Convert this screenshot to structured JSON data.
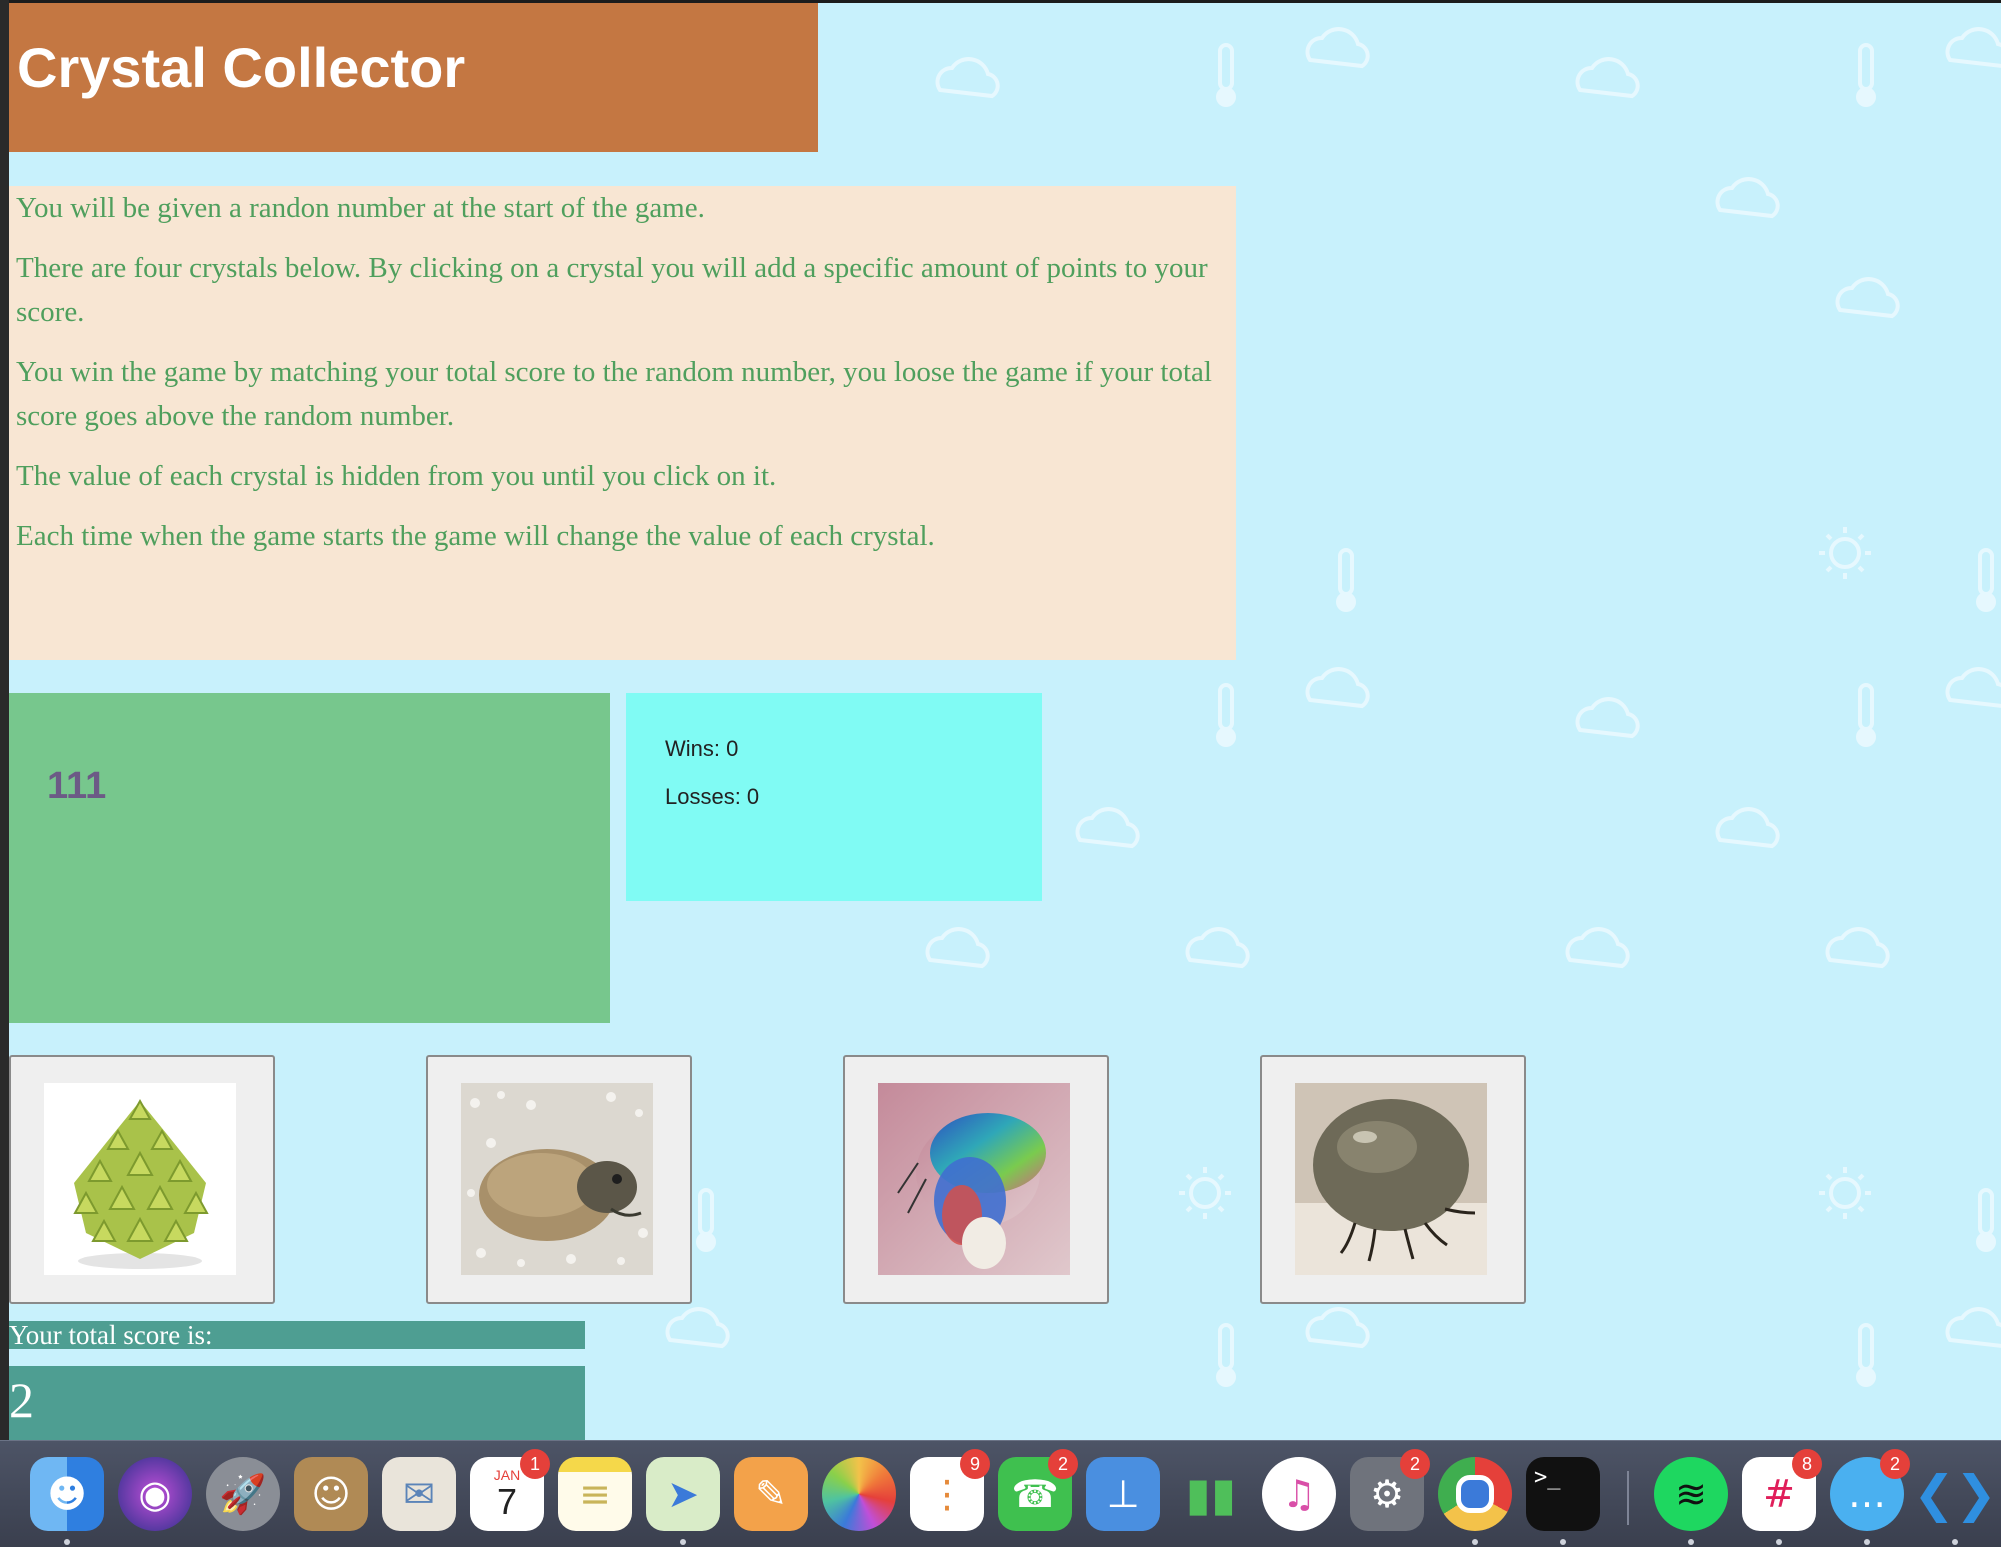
{
  "app": {
    "title": "Crystal Collector"
  },
  "instructions": [
    "You will be given a randon number at the start of the game.",
    "There are four crystals below. By clicking on a crystal you will add a specific amount of points to your score.",
    "You win the game by matching your total score to the random number, you loose the game if your total score goes above the random number.",
    "The value of each crystal is hidden from you until you click on it.",
    "Each time when the game starts the game will change the value of each crystal."
  ],
  "target_number": "111",
  "stats": {
    "wins": "Wins: 0",
    "losses": "Losses: 0"
  },
  "crystals": [
    {
      "image": "romanesco-broccoli"
    },
    {
      "image": "toad-in-sand"
    },
    {
      "image": "iridescent-beetle"
    },
    {
      "image": "engorged-tick"
    }
  ],
  "score": {
    "label": "Your total score is:",
    "value": "2"
  },
  "colors": {
    "page_bg": "#c8f1fc",
    "title_bg": "#c47742",
    "instructions_bg": "#f8e6d3",
    "instructions_text": "#4f9f5d",
    "target_bg": "#77c78d",
    "target_text": "#6c5a86",
    "stats_bg": "#80fbf4",
    "score_bg": "#4e9e92"
  },
  "dock": {
    "apps": [
      {
        "name": "Finder",
        "icon": "finder-icon",
        "running": true
      },
      {
        "name": "Siri",
        "icon": "siri-icon",
        "running": false
      },
      {
        "name": "Launchpad",
        "icon": "rocket-icon",
        "running": false
      },
      {
        "name": "Contacts",
        "icon": "contacts-icon",
        "running": false
      },
      {
        "name": "Mail",
        "icon": "stamp-icon",
        "running": false
      },
      {
        "name": "Calendar",
        "icon": "calendar-icon",
        "badge": "1",
        "month": "JAN",
        "day": "7",
        "running": false
      },
      {
        "name": "Notes",
        "icon": "notes-icon",
        "running": false
      },
      {
        "name": "Maps",
        "icon": "maps-icon",
        "running": true
      },
      {
        "name": "Pages",
        "icon": "pages-icon",
        "running": false
      },
      {
        "name": "Photos",
        "icon": "photos-icon",
        "running": false
      },
      {
        "name": "Reminders",
        "icon": "reminders-icon",
        "badge": "9",
        "running": false
      },
      {
        "name": "FaceTime",
        "icon": "facetime-icon",
        "badge": "2",
        "running": false
      },
      {
        "name": "Keynote",
        "icon": "keynote-icon",
        "running": false
      },
      {
        "name": "Numbers",
        "icon": "bar-chart-icon",
        "running": false
      },
      {
        "name": "iTunes",
        "icon": "music-note-icon",
        "running": false
      },
      {
        "name": "System Preferences",
        "icon": "gear-icon",
        "badge": "2",
        "running": false
      },
      {
        "name": "Chrome",
        "icon": "chrome-icon",
        "running": true
      },
      {
        "name": "Terminal",
        "icon": "terminal-icon",
        "running": true
      },
      {
        "name": "Spotify",
        "icon": "spotify-icon",
        "running": true
      },
      {
        "name": "Slack",
        "icon": "slack-icon",
        "badge": "8",
        "running": true
      },
      {
        "name": "Messages",
        "icon": "messages-icon",
        "badge": "2",
        "running": true
      },
      {
        "name": "VS Code",
        "icon": "vscode-icon",
        "running": true
      }
    ]
  }
}
